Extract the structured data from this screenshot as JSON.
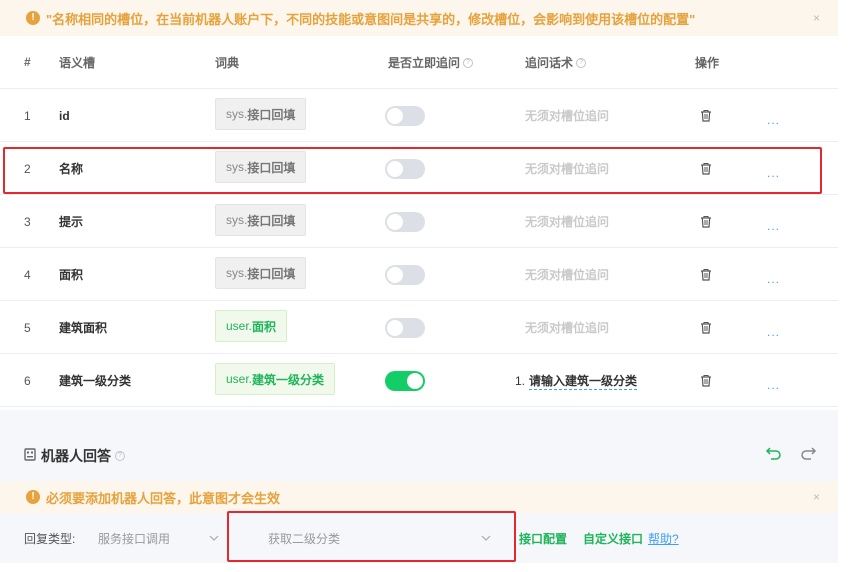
{
  "top_banner": {
    "icon": "!",
    "text": "\"名称相同的槽位，在当前机器人账户下，不同的技能或意图间是共享的，修改槽位，会影响到使用该槽位的配置\"",
    "close": "×"
  },
  "table": {
    "headers": {
      "index": "#",
      "slot": "语义槽",
      "dict": "词典",
      "ask_now": "是否立即追问",
      "ask_text": "追问话术",
      "ops": "操作"
    },
    "rows": [
      {
        "index": "1",
        "slot": "id",
        "dict_prefix": "sys.",
        "dict_name": "接口回填",
        "dict_type": "sys",
        "ask_now": false,
        "ask_text": "无须对槽位追问"
      },
      {
        "index": "2",
        "slot": "名称",
        "dict_prefix": "sys.",
        "dict_name": "接口回填",
        "dict_type": "sys",
        "ask_now": false,
        "ask_text": "无须对槽位追问"
      },
      {
        "index": "3",
        "slot": "提示",
        "dict_prefix": "sys.",
        "dict_name": "接口回填",
        "dict_type": "sys",
        "ask_now": false,
        "ask_text": "无须对槽位追问"
      },
      {
        "index": "4",
        "slot": "面积",
        "dict_prefix": "sys.",
        "dict_name": "接口回填",
        "dict_type": "sys",
        "ask_now": false,
        "ask_text": "无须对槽位追问"
      },
      {
        "index": "5",
        "slot": "建筑面积",
        "dict_prefix": "user.",
        "dict_name": "面积",
        "dict_type": "user",
        "ask_now": false,
        "ask_text": "无须对槽位追问"
      },
      {
        "index": "6",
        "slot": "建筑一级分类",
        "dict_prefix": "user.",
        "dict_name": "建筑一级分类",
        "dict_type": "user",
        "ask_now": true,
        "ask_num": "1.",
        "ask_text": "请输入建筑一级分类"
      }
    ],
    "more": "..."
  },
  "bot_reply": {
    "title": "机器人回答",
    "banner_icon": "!",
    "banner_text": "必须要添加机器人回答，此意图才会生效",
    "banner_close": "×",
    "reply_type_label": "回复类型:",
    "reply_type_value": "服务接口调用",
    "second_select_value": "获取二级分类",
    "link_api_config": "接口配置",
    "link_custom_api": "自定义接口",
    "link_help": "帮助?"
  },
  "colors": {
    "warning": "#e6a23c",
    "switch_on": "#13ce66",
    "user_dict_text": "#1fb55a",
    "highlight_border": "#e3282e",
    "link_blue": "#409eff"
  }
}
